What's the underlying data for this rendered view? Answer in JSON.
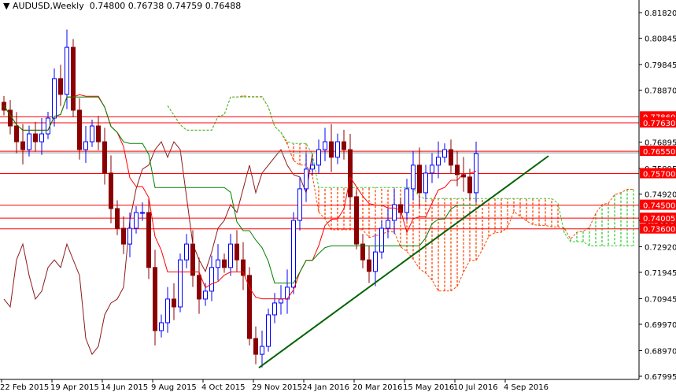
{
  "header": {
    "symbol": "AUDUSD,Weekly",
    "open": "0.74800",
    "high": "0.76738",
    "low": "0.74759",
    "close": "0.76488"
  },
  "colors": {
    "bull": "#0000ff",
    "bear": "#8b0000",
    "tenkan": "#ff0000",
    "kijun": "#008000",
    "chikou": "#8b1a1a",
    "cloud_bear": "#ff4500",
    "cloud_bull": "#32cd32",
    "level": "#ff0000",
    "trend": "#006400"
  },
  "chart_data": {
    "type": "candlestick",
    "title": "AUDUSD,Weekly",
    "ylim": [
      0.67995,
      0.8182
    ],
    "y_ticks": [
      "0.81820",
      "0.80845",
      "0.79845",
      "0.78870",
      "0.76895",
      "0.75895",
      "0.74920",
      "0.73920",
      "0.72920",
      "0.71945",
      "0.70945",
      "0.69970",
      "0.68970",
      "0.67995"
    ],
    "x_ticks": [
      "22 Feb 2015",
      "19 Apr 2015",
      "14 Jun 2015",
      "9 Aug 2015",
      "4 Oct 2015",
      "29 Nov 2015",
      "24 Jan 2016",
      "20 Mar 2016",
      "15 May 2016",
      "10 Jul 2016",
      "4 Sep 2016"
    ],
    "closes": [
      0.7811,
      0.7751,
      0.7691,
      0.7661,
      0.7721,
      0.7691,
      0.7721,
      0.7781,
      0.7931,
      0.7871,
      0.805,
      0.7811,
      0.7661,
      0.7691,
      0.7751,
      0.7691,
      0.7572,
      0.7437,
      0.7362,
      0.7302,
      0.7362,
      0.7422,
      0.7422,
      0.7213,
      0.6973,
      0.7003,
      0.7093,
      0.7063,
      0.7242,
      0.7302,
      0.7183,
      0.7093,
      0.7123,
      0.7213,
      0.7242,
      0.7213,
      0.7302,
      0.7242,
      0.7183,
      0.6943,
      0.6883,
      0.6913,
      0.7033,
      0.7078,
      0.7093,
      0.7138,
      0.7392,
      0.7512,
      0.7587,
      0.7602,
      0.7661,
      0.7691,
      0.7632,
      0.7691,
      0.7661,
      0.7482,
      0.7302,
      0.7242,
      0.7198,
      0.7272,
      0.7362,
      0.7392,
      0.7452,
      0.7422,
      0.7512,
      0.7602,
      0.7497,
      0.7572,
      0.7602,
      0.7632,
      0.7661,
      0.7602,
      0.7566,
      0.7557,
      0.7497,
      0.7646
    ],
    "current_price": "0.76488",
    "levels": [
      {
        "label": "0.77860",
        "value": 0.7786
      },
      {
        "label": "0.77630",
        "value": 0.7763
      },
      {
        "label": "0.76550",
        "value": 0.7655
      },
      {
        "label": "0.75700",
        "value": 0.757
      },
      {
        "label": "0.74500",
        "value": 0.745
      },
      {
        "label": "0.74005",
        "value": 0.74005
      },
      {
        "label": "0.73600",
        "value": 0.736
      }
    ],
    "trendline": {
      "from": {
        "week": 40.5,
        "price": 0.6832
      },
      "to": {
        "week": 86.5,
        "price": 0.7637
      }
    }
  }
}
